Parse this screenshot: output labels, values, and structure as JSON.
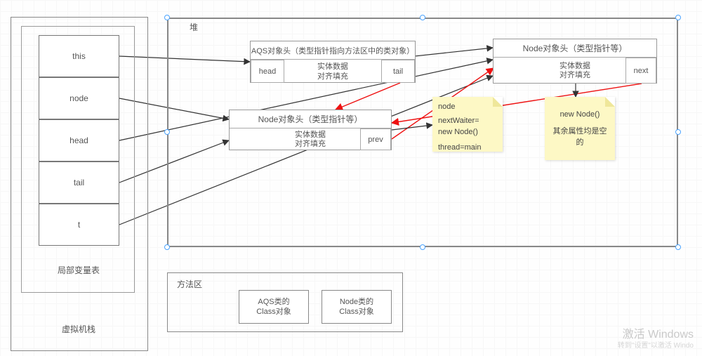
{
  "vmstack": {
    "label": "虚拟机栈",
    "localvar_label": "局部变量表",
    "slots": {
      "this": "this",
      "node": "node",
      "head": "head",
      "tail": "tail",
      "t": "t"
    }
  },
  "heap": {
    "label": "堆",
    "aqs": {
      "header": "AQS对象头（类型指针指向方法区中的类对象）",
      "body_line1": "实体数据",
      "body_line2": "对齐填充",
      "head_field": "head",
      "tail_field": "tail"
    },
    "nodeA": {
      "header": "Node对象头（类型指针等）",
      "body_line1": "实体数据",
      "body_line2": "对齐填充",
      "next_field": "next"
    },
    "nodeB": {
      "header": "Node对象头（类型指针等）",
      "body_line1": "实体数据",
      "body_line2": "对齐填充",
      "prev_field": "prev"
    },
    "note1": {
      "title": "node",
      "line1": "nextWaiter=",
      "line2": "new Node()",
      "line3": "thread=main"
    },
    "note2": {
      "line1": "new Node()",
      "line2": "其余属性均是空的"
    }
  },
  "method_area": {
    "label": "方法区",
    "class_aqs": "AQS类的\nClass对象",
    "class_node": "Node类的\nClass对象"
  },
  "watermark": {
    "line1": "激活 Windows",
    "line2": "转到\"设置\"以激活 Windo"
  }
}
